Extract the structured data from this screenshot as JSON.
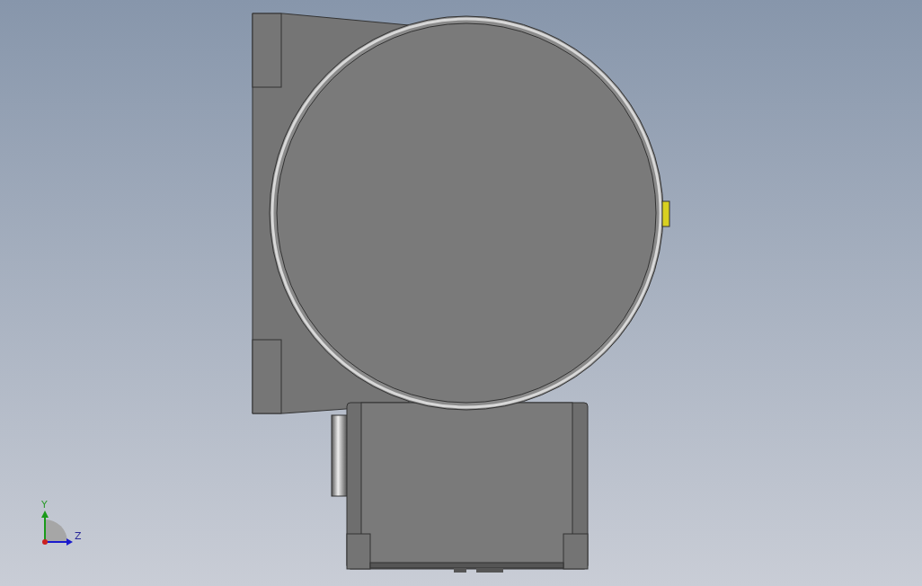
{
  "viewport": {
    "triad": {
      "axes": [
        {
          "label": "Y",
          "kind": "vertical"
        },
        {
          "label": "Z",
          "kind": "horizontal"
        }
      ]
    }
  }
}
